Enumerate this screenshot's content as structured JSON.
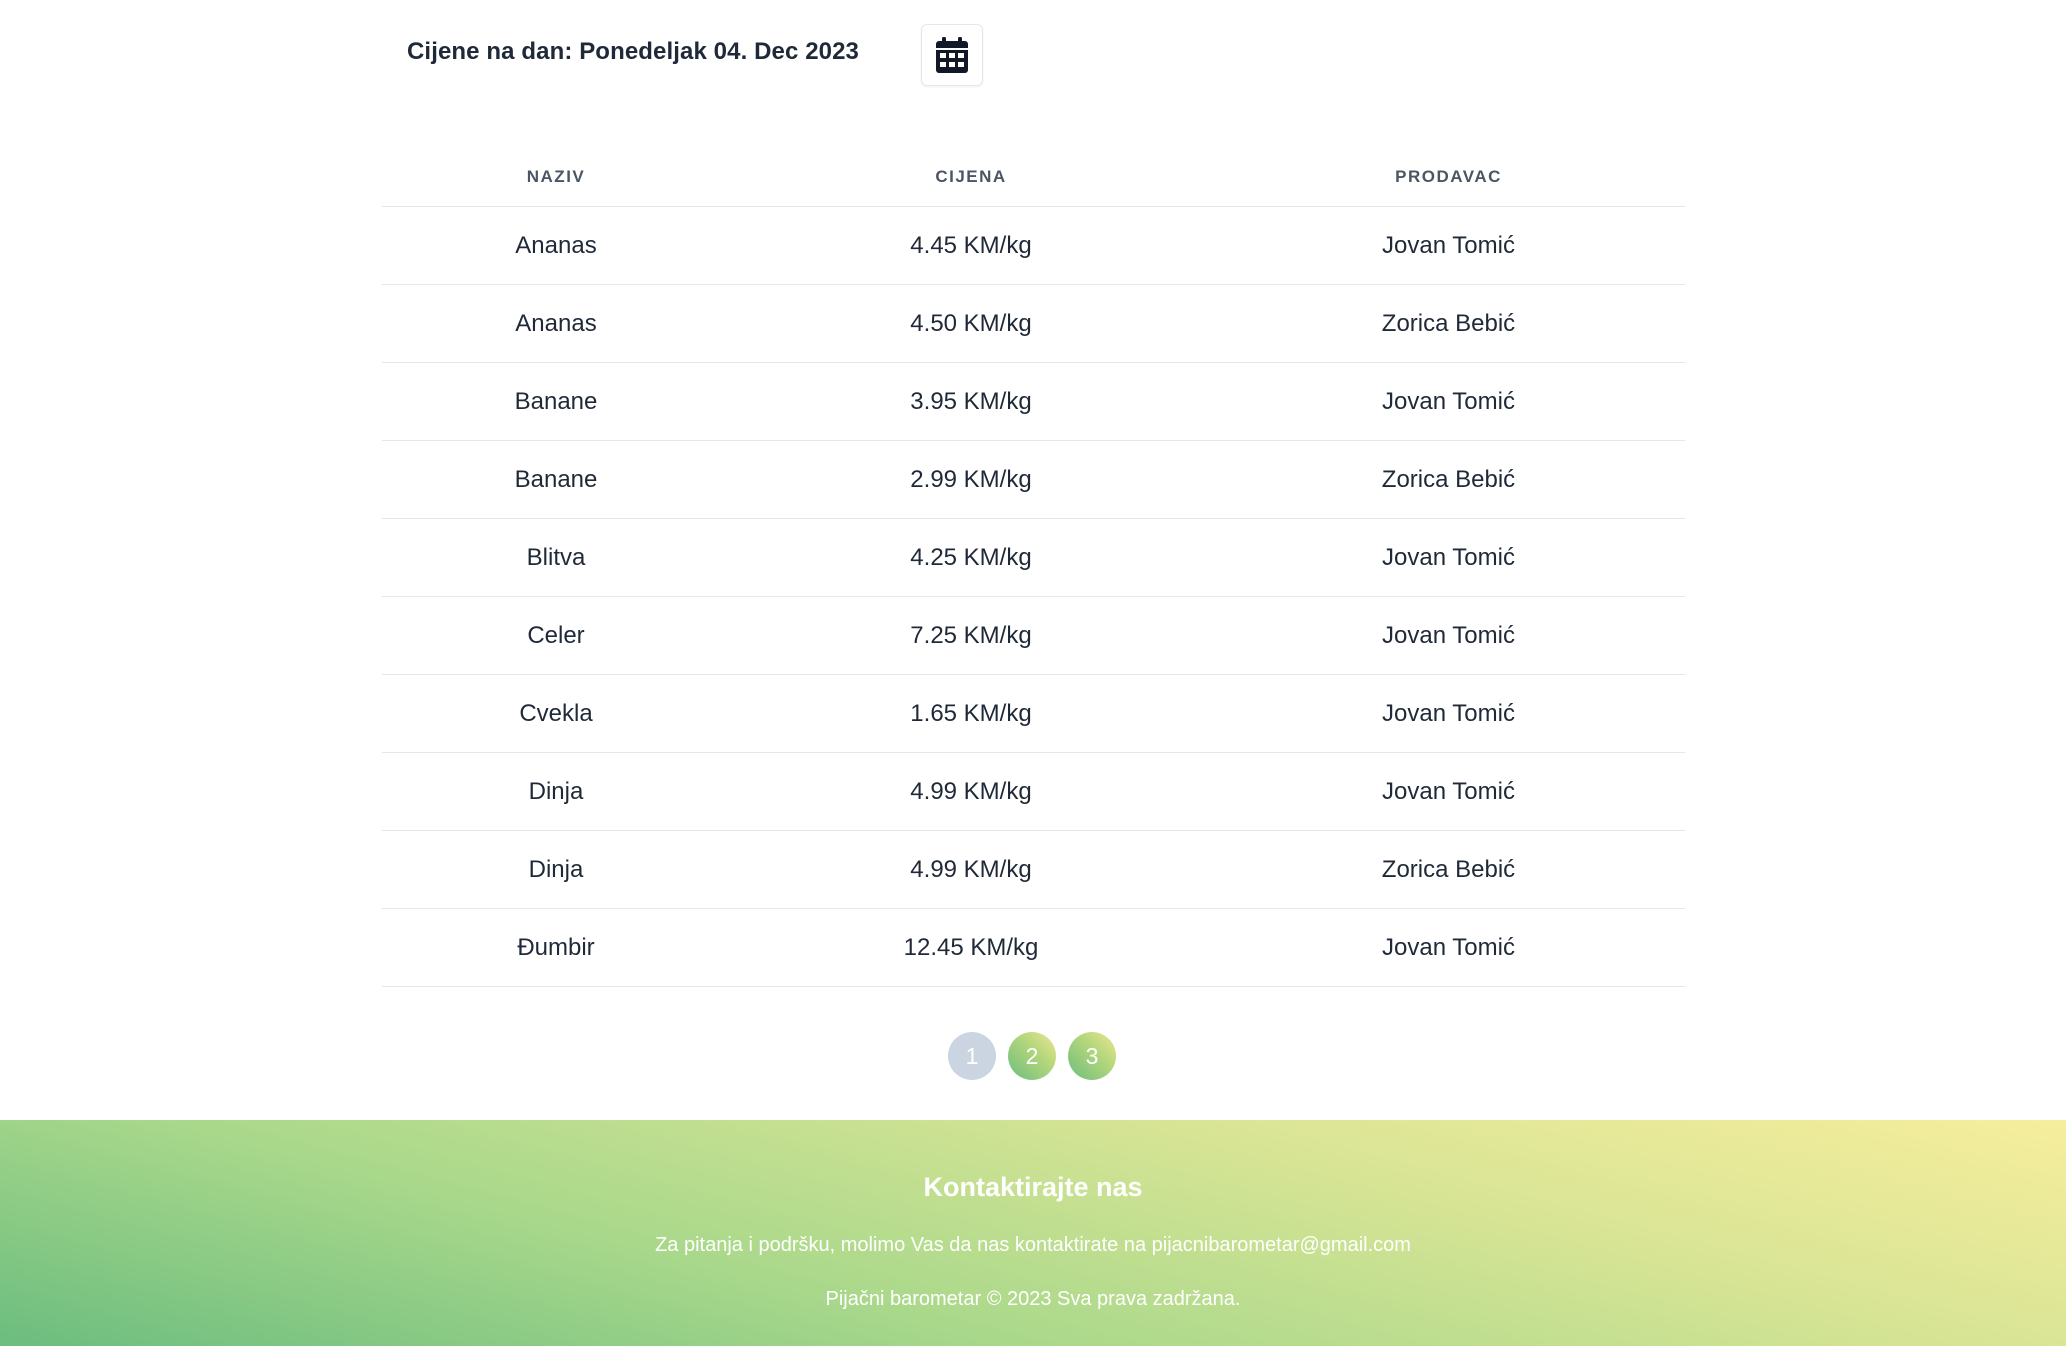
{
  "header": {
    "date_label": "Cijene na dan: Ponedeljak 04. Dec 2023",
    "calendar_icon": "calendar-icon"
  },
  "table": {
    "columns": [
      "NAZIV",
      "CIJENA",
      "PRODAVAC"
    ],
    "rows": [
      {
        "name": "Ananas",
        "price": "4.45 KM/kg",
        "seller": "Jovan Tomić"
      },
      {
        "name": "Ananas",
        "price": "4.50 KM/kg",
        "seller": "Zorica Bebić"
      },
      {
        "name": "Banane",
        "price": "3.95 KM/kg",
        "seller": "Jovan Tomić"
      },
      {
        "name": "Banane",
        "price": "2.99 KM/kg",
        "seller": "Zorica Bebić"
      },
      {
        "name": "Blitva",
        "price": "4.25 KM/kg",
        "seller": "Jovan Tomić"
      },
      {
        "name": "Celer",
        "price": "7.25 KM/kg",
        "seller": "Jovan Tomić"
      },
      {
        "name": "Cvekla",
        "price": "1.65 KM/kg",
        "seller": "Jovan Tomić"
      },
      {
        "name": "Dinja",
        "price": "4.99 KM/kg",
        "seller": "Jovan Tomić"
      },
      {
        "name": "Dinja",
        "price": "4.99 KM/kg",
        "seller": "Zorica Bebić"
      },
      {
        "name": "Đumbir",
        "price": "12.45 KM/kg",
        "seller": "Jovan Tomić"
      }
    ]
  },
  "pagination": {
    "pages": [
      "1",
      "2",
      "3"
    ],
    "current": "1"
  },
  "footer": {
    "title": "Kontaktirajte nas",
    "text": "Za pitanja i podršku, molimo Vas da nas kontaktirate na pijacnibarometar@gmail.com",
    "copyright": "Pijačni barometar © 2023 Sva prava zadržana."
  },
  "colors": {
    "active_page": "#cbd5e1",
    "footer_gradient_start": "#6cbd7f",
    "footer_gradient_end": "#f6ee9d",
    "text_dark": "#1f2937"
  }
}
